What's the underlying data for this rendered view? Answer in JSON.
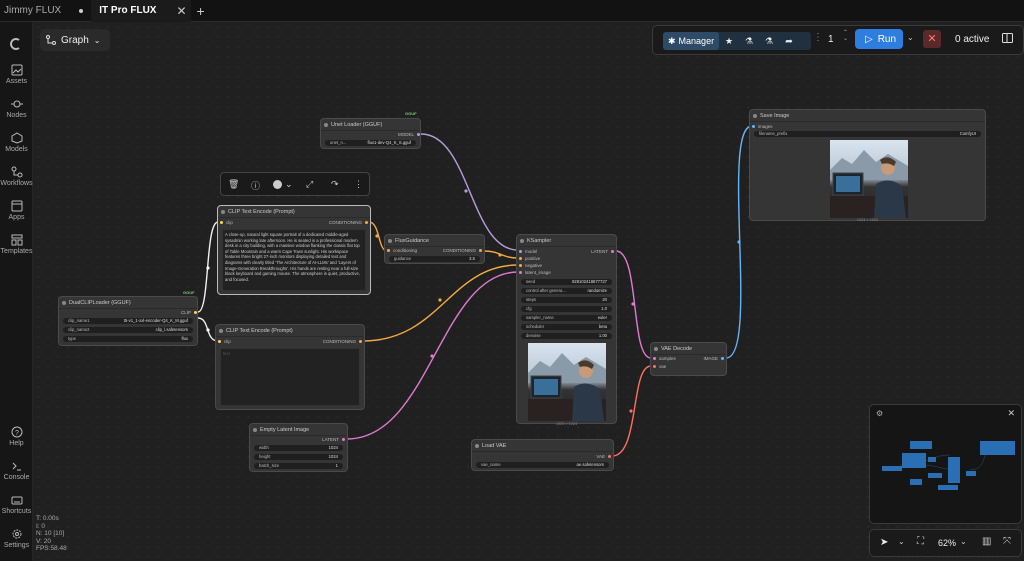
{
  "tabs": [
    {
      "label": "Jimmy FLUX"
    },
    {
      "label": "IT Pro FLUX"
    }
  ],
  "sidebar": [
    {
      "label": "Assets",
      "icon": "image-icon"
    },
    {
      "label": "Nodes",
      "icon": "node-icon"
    },
    {
      "label": "Models",
      "icon": "cube-icon"
    },
    {
      "label": "Workflows",
      "icon": "workflow-icon"
    },
    {
      "label": "Apps",
      "icon": "apps-icon"
    },
    {
      "label": "Templates",
      "icon": "templates-icon"
    },
    {
      "label": "Help",
      "icon": "help-icon"
    },
    {
      "label": "Console",
      "icon": "terminal-icon"
    },
    {
      "label": "Shortcuts",
      "icon": "keyboard-icon"
    },
    {
      "label": "Settings",
      "icon": "gear-icon"
    }
  ],
  "graph_label": "Graph",
  "toolbar": {
    "manager": "Manager",
    "queue_count": "1",
    "run": "Run",
    "active": "0 active"
  },
  "zoom": "62%",
  "stats": [
    "T: 0.00s",
    "I: 0",
    "N: 10 [10]",
    "V: 20",
    "FPS:58.48"
  ],
  "nodes": {
    "unet": {
      "title": "Unet Loader (GGUF)",
      "badge": "GGUF",
      "out": "MODEL",
      "w_label": "unet_n...",
      "w_value": "flux1-dev-Q4_K_S.gguf"
    },
    "dualclip": {
      "title": "DualCLIPLoader (GGUF)",
      "badge": "GGUF",
      "out": "CLIP",
      "w": [
        {
          "l": "clip_name1",
          "v": "t5-v1_1-xxl-encoder-Q4_K_M.gguf"
        },
        {
          "l": "clip_name2",
          "v": "clip_l.safetensors"
        },
        {
          "l": "type",
          "v": "flux"
        }
      ]
    },
    "clip_pos": {
      "title": "CLIP Text Encode (Prompt)",
      "in": "clip",
      "out": "CONDITIONING",
      "text": "A close-up, natural light square portrait of a dedicated middle-aged sysadmin working late afternoon. He is seated in a professional modern desk in a city building, with a massive window flanking the classic flat top of Table Mountain and a warm Cape Town sunlight. His workspace features three bright 27-inch monitors displaying detailed text and diagrams with clearly titled 'The Architecture of AI-LLMs' and 'Layers of Image-Generation Breakthroughs'. His hands are resting near a full-size black keyboard and gaming mouse. The atmosphere is quiet, productive, and focused."
    },
    "clip_neg": {
      "title": "CLIP Text Encode (Prompt)",
      "in": "clip",
      "out": "CONDITIONING",
      "text": "text"
    },
    "guidance": {
      "title": "FluxGuidance",
      "in": "conditioning",
      "out": "CONDITIONING",
      "w_label": "guidance",
      "w_value": "3.5"
    },
    "ksampler": {
      "title": "KSampler",
      "ins": [
        "model",
        "positive",
        "negative",
        "latent_image"
      ],
      "out": "LATENT",
      "w": [
        {
          "l": "seed",
          "v": "828102418677727"
        },
        {
          "l": "control after genera...",
          "v": "randomize"
        },
        {
          "l": "steps",
          "v": "20"
        },
        {
          "l": "cfg",
          "v": "1.0"
        },
        {
          "l": "sampler_name",
          "v": "euler"
        },
        {
          "l": "scheduler",
          "v": "beta"
        },
        {
          "l": "denoise",
          "v": "1.00"
        }
      ],
      "caption": "1024 × 1024"
    },
    "empty_latent": {
      "title": "Empty Latent Image",
      "out": "LATENT",
      "w": [
        {
          "l": "width",
          "v": "1024"
        },
        {
          "l": "height",
          "v": "1024"
        },
        {
          "l": "batch_size",
          "v": "1"
        }
      ]
    },
    "vae_decode": {
      "title": "VAE Decode",
      "ins": [
        "samples",
        "vae"
      ],
      "out": "IMAGE"
    },
    "vae_loader": {
      "title": "Load VAE",
      "out": "VAE",
      "w_label": "vae_name",
      "w_value": "ae.safetensors"
    },
    "save": {
      "title": "Save Image",
      "in": "images",
      "w_label": "filename_prefix",
      "w_value": "ComfyUI",
      "caption": "1024 × 1024"
    }
  }
}
